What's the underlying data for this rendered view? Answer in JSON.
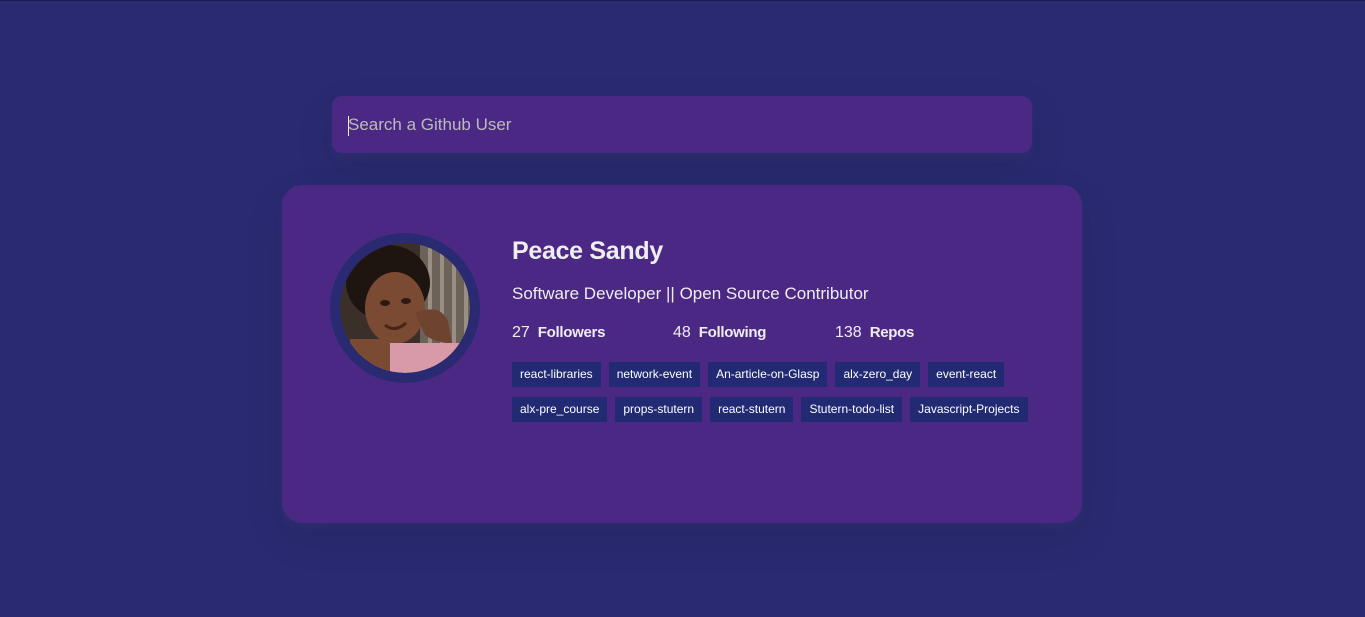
{
  "search": {
    "placeholder": "Search a Github User",
    "value": ""
  },
  "profile": {
    "name": "Peace Sandy",
    "bio": "Software Developer || Open Source Contributor",
    "stats": {
      "followers_count": "27",
      "followers_label": "Followers",
      "following_count": "48",
      "following_label": "Following",
      "repos_count": "138",
      "repos_label": "Repos"
    },
    "repos": [
      "react-libraries",
      "network-event",
      "An-article-on-Glasp",
      "alx-zero_day",
      "event-react",
      "alx-pre_course",
      "props-stutern",
      "react-stutern",
      "Stutern-todo-list",
      "Javascript-Projects"
    ]
  },
  "colors": {
    "background": "#2a2a72",
    "card": "#4c2885",
    "repo_tag": "#212a72",
    "text": "#eeeeee"
  }
}
